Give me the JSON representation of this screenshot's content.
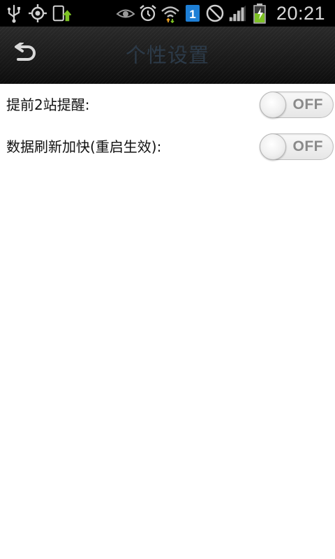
{
  "status_bar": {
    "time": "20:21",
    "sim_badge": "1",
    "left_icons": [
      "usb-icon",
      "gps-icon",
      "phone-update-icon"
    ],
    "right_icons": [
      "eye-icon",
      "alarm-icon",
      "wifi-icon",
      "sim-icon",
      "blocked-icon",
      "signal-icon",
      "battery-charging-icon"
    ]
  },
  "header": {
    "title": "个性设置",
    "back_icon": "back-arrow-icon"
  },
  "settings": [
    {
      "label": "提前2站提醒:",
      "state": "OFF"
    },
    {
      "label": "数据刷新加快(重启生效):",
      "state": "OFF"
    }
  ],
  "colors": {
    "status_bar": "#000000",
    "title_bar": "#1a1a1a",
    "title_text": "#2c3a48",
    "background": "#ffffff",
    "toggle_text": "#8a8a8a",
    "battery_green": "#7ec225"
  }
}
